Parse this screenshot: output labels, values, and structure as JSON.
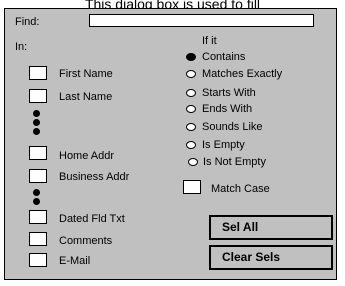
{
  "caption": "This dialog box is used to fill",
  "find": {
    "label": "Find:",
    "value": ""
  },
  "in_label": "In:",
  "if_label": "If it",
  "fields": [
    {
      "label": "First Name"
    },
    {
      "label": "Last Name"
    },
    {
      "label": "Home Addr"
    },
    {
      "label": "Business Addr"
    },
    {
      "label": "Dated Fld Txt"
    },
    {
      "label": "Comments"
    },
    {
      "label": "E-Mail"
    }
  ],
  "conditions": [
    {
      "label": "Contains",
      "selected": true
    },
    {
      "label": "Matches Exactly",
      "selected": false
    },
    {
      "label": "Starts With",
      "selected": false
    },
    {
      "label": "Ends With",
      "selected": false
    },
    {
      "label": "Sounds Like",
      "selected": false
    },
    {
      "label": "Is Empty",
      "selected": false
    },
    {
      "label": "Is Not Empty",
      "selected": false
    }
  ],
  "match_case": {
    "label": "Match Case",
    "checked": false
  },
  "buttons": {
    "sel_all": "Sel All",
    "clear_sels": "Clear Sels"
  }
}
